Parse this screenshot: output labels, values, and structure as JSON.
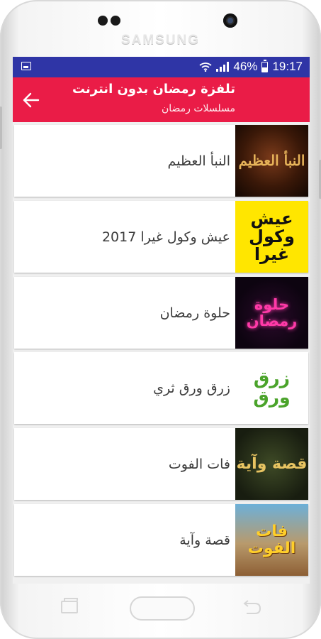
{
  "device": {
    "brand": "SAMSUNG"
  },
  "status_bar": {
    "battery_percent": "46%",
    "time": "19:17",
    "icons": [
      "image-icon",
      "wifi-icon",
      "signal-icon",
      "battery-icon"
    ]
  },
  "app_bar": {
    "title": "تلفزة رمضان بدون انترنت",
    "subtitle": "مسلسلات رمضان",
    "back_icon": "arrow-back-icon",
    "color": "#ea1c47"
  },
  "status_bar_color": "#2f35a6",
  "list": {
    "items": [
      {
        "label": "النبأ العظيم",
        "thumb_text": "النبأ العظيم"
      },
      {
        "label": "عيش وكول غيرا 2017",
        "thumb_text": "عيش وكول غيرا"
      },
      {
        "label": "حلوة رمضان",
        "thumb_text": "حلوة رمضان"
      },
      {
        "label": "زرق ورق ثري",
        "thumb_text": "زرق ورق"
      },
      {
        "label": "فات الفوت",
        "thumb_text": "قصة وآية"
      },
      {
        "label": "قصة وآية",
        "thumb_text": "فات الفوت"
      }
    ]
  },
  "nav_bar": {
    "icons": [
      "recent-apps-icon",
      "home-button",
      "back-nav-icon"
    ]
  }
}
